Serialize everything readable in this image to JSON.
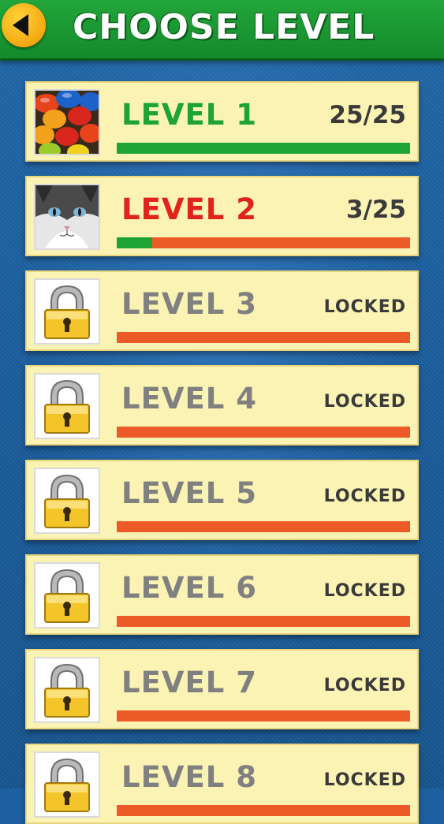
{
  "header": {
    "title": "CHOOSE LEVEL",
    "back_icon": "back-arrow-icon",
    "color": "#1a9a33"
  },
  "colors": {
    "complete": "#1ea335",
    "in_progress": "#e0231b",
    "locked": "#808080",
    "progress_track": "#ec5a27",
    "progress_fill": "#1ea335",
    "card_bg": "#fbf3b4"
  },
  "levels": [
    {
      "name": "LEVEL 1",
      "status": "25/25",
      "state": "complete",
      "progress": 1.0,
      "thumbnail": "candy-thumbnail"
    },
    {
      "name": "LEVEL 2",
      "status": "3/25",
      "state": "in_progress",
      "progress": 0.12,
      "thumbnail": "cat-thumbnail"
    },
    {
      "name": "LEVEL 3",
      "status": "LOCKED",
      "state": "locked",
      "progress": 0,
      "thumbnail": "padlock-icon"
    },
    {
      "name": "LEVEL 4",
      "status": "LOCKED",
      "state": "locked",
      "progress": 0,
      "thumbnail": "padlock-icon"
    },
    {
      "name": "LEVEL 5",
      "status": "LOCKED",
      "state": "locked",
      "progress": 0,
      "thumbnail": "padlock-icon"
    },
    {
      "name": "LEVEL 6",
      "status": "LOCKED",
      "state": "locked",
      "progress": 0,
      "thumbnail": "padlock-icon"
    },
    {
      "name": "LEVEL 7",
      "status": "LOCKED",
      "state": "locked",
      "progress": 0,
      "thumbnail": "padlock-icon"
    },
    {
      "name": "LEVEL 8",
      "status": "LOCKED",
      "state": "locked",
      "progress": 0,
      "thumbnail": "padlock-icon"
    }
  ]
}
